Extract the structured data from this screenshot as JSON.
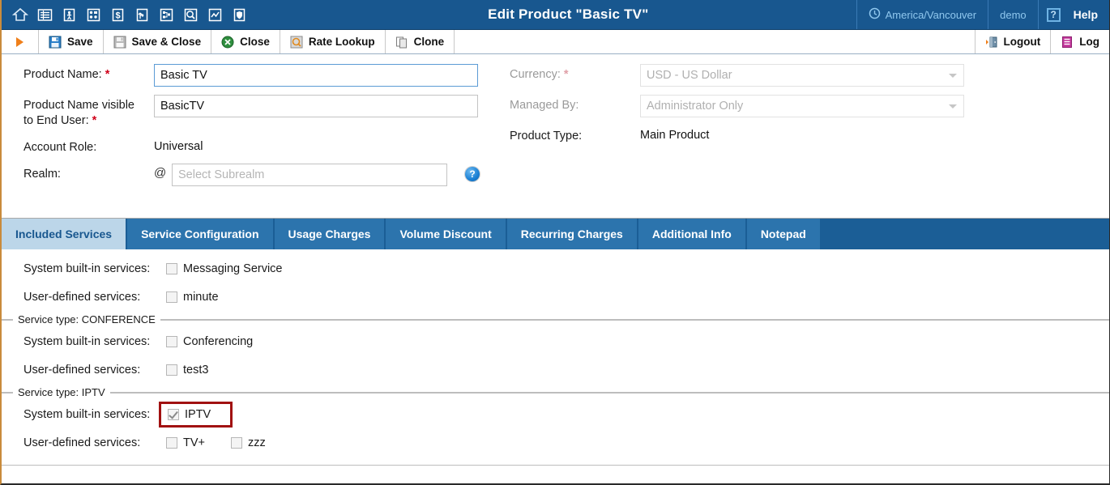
{
  "header": {
    "title": "Edit Product \"Basic TV\"",
    "nav_icons": [
      {
        "name": "home-icon"
      },
      {
        "name": "list-icon"
      },
      {
        "name": "person-icon"
      },
      {
        "name": "grid-icon"
      },
      {
        "name": "dollar-icon"
      },
      {
        "name": "route-icon"
      },
      {
        "name": "nodes-icon"
      },
      {
        "name": "search-icon"
      },
      {
        "name": "chart-icon"
      },
      {
        "name": "shield-icon"
      }
    ],
    "timezone": "America/Vancouver",
    "user": "demo",
    "help_label": "Help",
    "help_q": "?"
  },
  "toolbar": {
    "play": "▶",
    "buttons": [
      {
        "label": "Save",
        "icon": "save-icon"
      },
      {
        "label": "Save & Close",
        "icon": "save-close-icon"
      },
      {
        "label": "Close",
        "icon": "close-icon"
      },
      {
        "label": "Rate Lookup",
        "icon": "rate-lookup-icon"
      },
      {
        "label": "Clone",
        "icon": "clone-icon"
      }
    ],
    "right_buttons": [
      {
        "label": "Logout",
        "icon": "logout-icon"
      },
      {
        "label": "Log",
        "icon": "log-icon"
      }
    ]
  },
  "form": {
    "product_name": {
      "label": "Product Name:",
      "required": "*",
      "value": "Basic TV",
      "placeholder": ""
    },
    "product_name_end_user": {
      "label_line1": "Product Name visible",
      "label_line2": "to End User:",
      "required": "*",
      "value": "BasicTV",
      "placeholder": ""
    },
    "account_role": {
      "label": "Account Role:",
      "value": "Universal"
    },
    "realm": {
      "label": "Realm:",
      "at": "@",
      "value": "",
      "placeholder": "Select Subrealm",
      "help_icon_char": "?"
    },
    "currency": {
      "label": "Currency:",
      "required": "*",
      "value": "USD - US Dollar",
      "disabled": true
    },
    "managed_by": {
      "label": "Managed By:",
      "value": "Administrator Only",
      "disabled": true
    },
    "product_type": {
      "label": "Product Type:",
      "value": "Main Product"
    }
  },
  "tabs": [
    {
      "label": "Included Services",
      "active": true
    },
    {
      "label": "Service Configuration",
      "active": false
    },
    {
      "label": "Usage Charges",
      "active": false
    },
    {
      "label": "Volume Discount",
      "active": false
    },
    {
      "label": "Recurring Charges",
      "active": false
    },
    {
      "label": "Additional Info",
      "active": false
    },
    {
      "label": "Notepad",
      "active": false
    }
  ],
  "services": {
    "row_labels": {
      "builtin": "System built-in services:",
      "userdef": "User-defined services:"
    },
    "groups": [
      {
        "legend": "",
        "builtin": [
          {
            "label": "Messaging Service",
            "checked": false
          }
        ],
        "userdef": [
          {
            "label": "minute",
            "checked": false
          }
        ],
        "highlight": false
      },
      {
        "legend": "Service type: CONFERENCE",
        "builtin": [
          {
            "label": "Conferencing",
            "checked": false
          }
        ],
        "userdef": [
          {
            "label": "test3",
            "checked": false
          }
        ],
        "highlight": false
      },
      {
        "legend": "Service type: IPTV",
        "builtin": [
          {
            "label": "IPTV",
            "checked": true
          }
        ],
        "userdef": [
          {
            "label": "TV+",
            "checked": false
          },
          {
            "label": "zzz",
            "checked": false
          }
        ],
        "highlight": true
      }
    ]
  },
  "colors": {
    "header_blue": "#18578f",
    "tab_blue": "#2c74ad",
    "tab_active": "#bcd6e9",
    "highlight_red": "#a11111",
    "required_red": "#d0021b",
    "accent_orange": "#ef7f1a"
  }
}
